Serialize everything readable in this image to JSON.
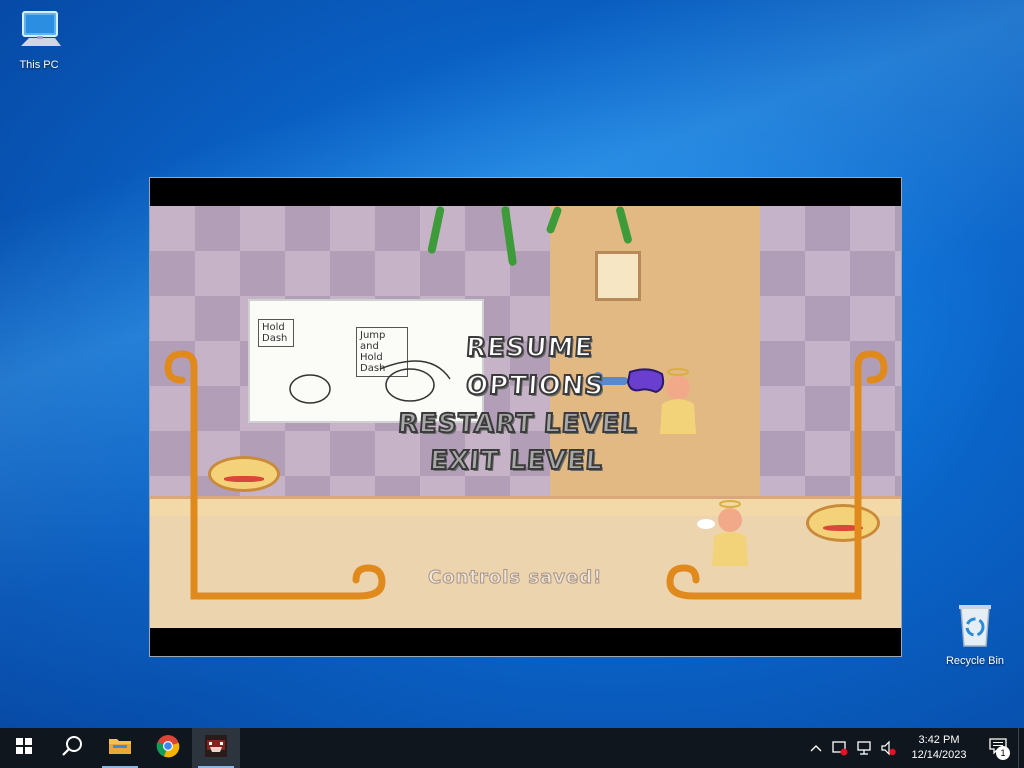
{
  "desktop": {
    "icons": [
      {
        "label": "This PC",
        "icon": "computer-icon"
      },
      {
        "label": "Recycle Bin",
        "icon": "recycle-bin-icon"
      }
    ]
  },
  "game": {
    "pause_menu": {
      "items": [
        {
          "label": "RESUME"
        },
        {
          "label": "OPTIONS"
        },
        {
          "label": "RESTART LEVEL"
        },
        {
          "label": "EXIT LEVEL"
        }
      ]
    },
    "toast": "Controls saved!",
    "tutorial": {
      "sign_left": "Hold Dash",
      "sign_right": "Jump and Hold Dash"
    }
  },
  "taskbar": {
    "apps": [
      {
        "name": "start-button",
        "icon": "windows-logo-icon"
      },
      {
        "name": "search-button",
        "icon": "search-icon"
      },
      {
        "name": "file-explorer",
        "icon": "folder-icon"
      },
      {
        "name": "chrome",
        "icon": "chrome-icon"
      },
      {
        "name": "game",
        "icon": "game-app-icon",
        "active": true
      }
    ],
    "tray": {
      "time": "3:42 PM",
      "date": "12/14/2023",
      "notification_count": "1"
    }
  },
  "colors": {
    "taskbar_bg": "#10161d",
    "menu_frame": "#e08a1e",
    "menu_text": "#ffffff"
  }
}
